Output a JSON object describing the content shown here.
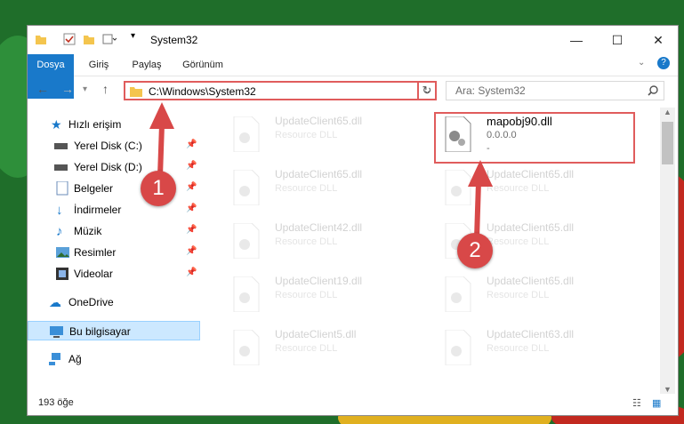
{
  "window": {
    "title": "System32"
  },
  "ribbon": {
    "tabs": [
      "Dosya",
      "Giriş",
      "Paylaş",
      "Görünüm"
    ]
  },
  "nav": {
    "address": "C:\\Windows\\System32",
    "search_placeholder": "Ara: System32"
  },
  "sidebar": {
    "quick_access": "Hızlı erişim",
    "items": [
      {
        "label": "Yerel Disk (C:)"
      },
      {
        "label": "Yerel Disk (D:)"
      },
      {
        "label": "Belgeler"
      },
      {
        "label": "İndirmeler"
      },
      {
        "label": "Müzik"
      },
      {
        "label": "Resimler"
      },
      {
        "label": "Videolar"
      }
    ],
    "onedrive": "OneDrive",
    "this_pc": "Bu bilgisayar",
    "network": "Ağ"
  },
  "files": {
    "left": [
      {
        "name": "UpdateClient65.dll",
        "desc": "Resource DLL"
      },
      {
        "name": "UpdateClient65.dll",
        "desc": "Resource DLL"
      },
      {
        "name": "UpdateClient42.dll",
        "desc": "Resource DLL"
      },
      {
        "name": "UpdateClient19.dll",
        "desc": "Resource DLL"
      },
      {
        "name": "UpdateClient5.dll",
        "desc": "Resource DLL"
      }
    ],
    "right": [
      {
        "name": "mapobj90.dll",
        "desc": "0.0.0.0",
        "extra": "-"
      },
      {
        "name": "UpdateClient65.dll",
        "desc": "Resource DLL"
      },
      {
        "name": "UpdateClient65.dll",
        "desc": "Resource DLL"
      },
      {
        "name": "UpdateClient65.dll",
        "desc": "Resource DLL"
      },
      {
        "name": "UpdateClient63.dll",
        "desc": "Resource DLL"
      }
    ]
  },
  "status": {
    "count": "193 öğe"
  },
  "annotations": {
    "marker1": "1",
    "marker2": "2"
  },
  "colors": {
    "accent": "#1979ca",
    "highlight": "#e05c5c",
    "marker": "#d84848"
  }
}
